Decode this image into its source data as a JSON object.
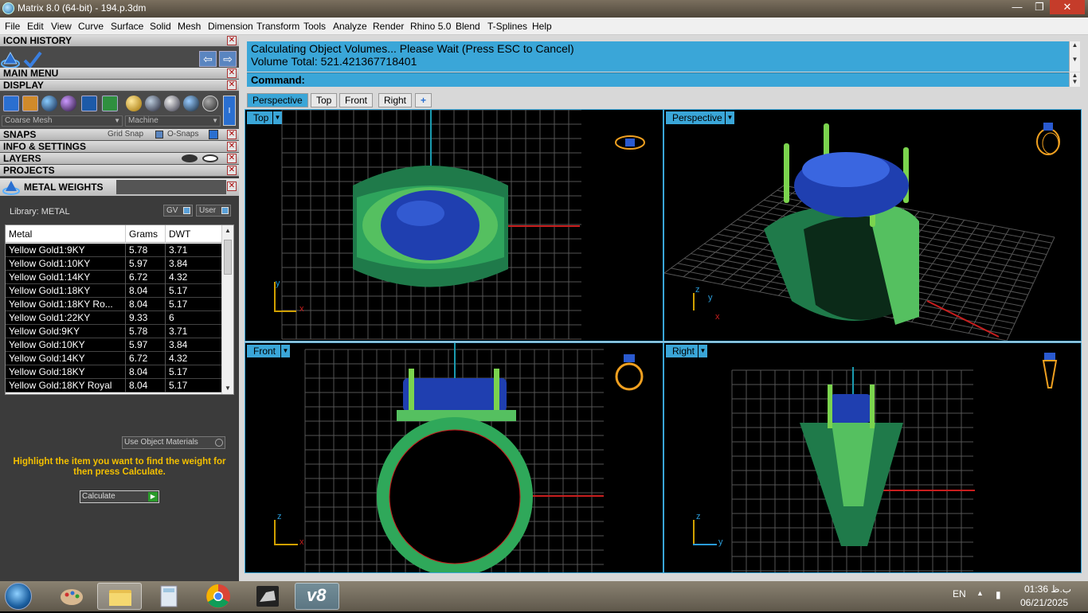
{
  "window": {
    "title": "Matrix 8.0 (64-bit) - 194.p.3dm",
    "min_glyph": "—",
    "max_glyph": "❐",
    "close_glyph": "✕"
  },
  "menubar": [
    "File",
    "Edit",
    "View",
    "Curve",
    "Surface",
    "Solid",
    "Mesh",
    "Dimension",
    "Transform",
    "Tools",
    "Analyze",
    "Render",
    "Rhino 5.0",
    "Blend",
    "T-Splines",
    "Help"
  ],
  "left_panel": {
    "icon_history": "ICON HISTORY",
    "main_menu": "MAIN MENU",
    "display": "DISPLAY",
    "mesh_select": "Coarse Mesh",
    "material_select": "Machine",
    "snaps": "SNAPS",
    "grid_snap": "Grid Snap",
    "o_snaps": "O-Snaps",
    "info_settings": "INFO & SETTINGS",
    "layers": "LAYERS",
    "projects": "PROJECTS",
    "metal_weights": "METAL WEIGHTS",
    "library_label": "Library: METAL",
    "gv_button": "GV",
    "user_button": "User",
    "use_object_materials": "Use Object Materials",
    "hint": "Highlight the item you want to find the weight for then press Calculate.",
    "calculate": "Calculate",
    "close_glyph": "✕"
  },
  "metal_table": {
    "columns": [
      "Metal",
      "Grams",
      "DWT"
    ],
    "rows": [
      [
        "Yellow Gold1:9KY",
        "5.78",
        "3.71"
      ],
      [
        "Yellow Gold1:10KY",
        "5.97",
        "3.84"
      ],
      [
        "Yellow Gold1:14KY",
        "6.72",
        "4.32"
      ],
      [
        "Yellow Gold1:18KY",
        "8.04",
        "5.17"
      ],
      [
        "Yellow Gold1:18KY Ro...",
        "8.04",
        "5.17"
      ],
      [
        "Yellow Gold1:22KY",
        "9.33",
        "6"
      ],
      [
        "Yellow Gold:9KY",
        "5.78",
        "3.71"
      ],
      [
        "Yellow Gold:10KY",
        "5.97",
        "3.84"
      ],
      [
        "Yellow Gold:14KY",
        "6.72",
        "4.32"
      ],
      [
        "Yellow Gold:18KY",
        "8.04",
        "5.17"
      ],
      [
        "Yellow Gold:18KY Royal",
        "8.04",
        "5.17"
      ]
    ]
  },
  "command": {
    "line1": "Calculating Object Volumes... Please Wait (Press ESC to Cancel)",
    "line2": "Volume Total: 521.421367718401",
    "prompt": "Command:"
  },
  "viewport_tabs": [
    "Perspective",
    "Top",
    "Front",
    "Right",
    "+"
  ],
  "viewports": {
    "top_left": "Top",
    "top_right": "Perspective",
    "bottom_left": "Front",
    "bottom_right": "Right"
  },
  "axes": {
    "x": "x",
    "y": "y",
    "z": "z"
  },
  "taskbar": {
    "lang": "EN",
    "time": "01:36 ب.ظ",
    "date": "06/21/2025",
    "v8_label": "v8"
  },
  "colors": {
    "accent": "#3aa6d8",
    "ring_green": "#2fa85a",
    "stone_blue": "#1f3fb0",
    "hint_yellow": "#f4c000"
  }
}
